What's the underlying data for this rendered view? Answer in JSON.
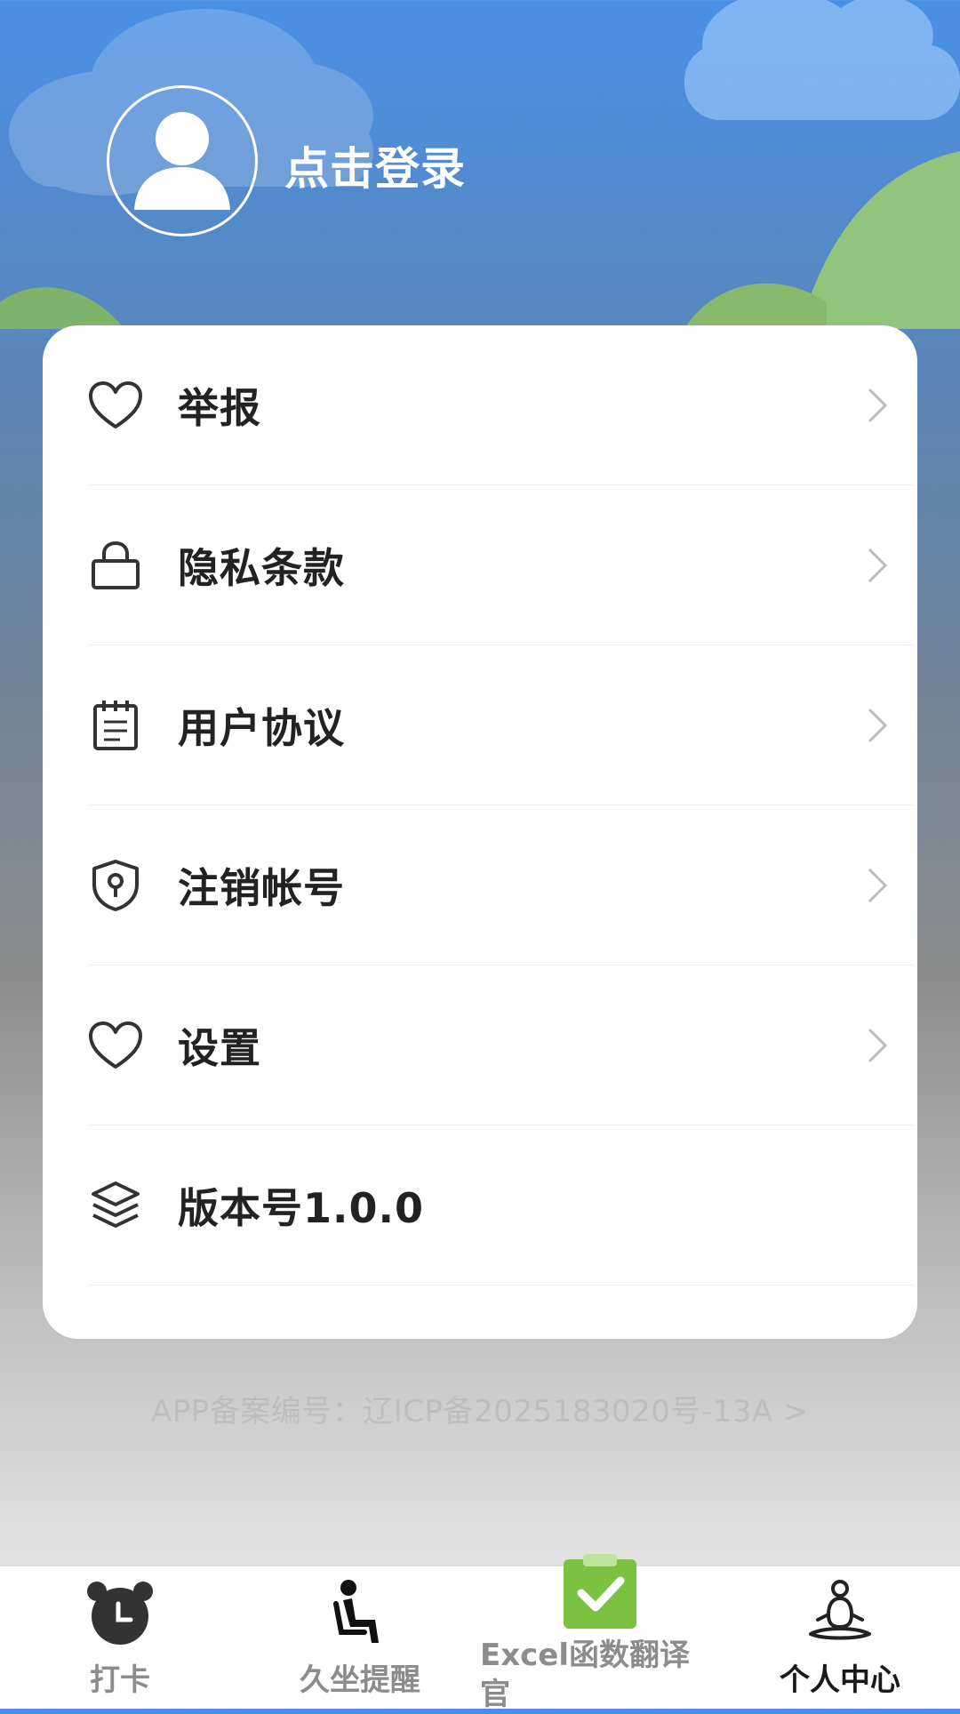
{
  "header": {
    "login_text": "点击登录"
  },
  "menu": [
    {
      "label": "举报",
      "icon": "heart-icon",
      "has_arrow": true
    },
    {
      "label": "隐私条款",
      "icon": "lock-icon",
      "has_arrow": true
    },
    {
      "label": "用户协议",
      "icon": "notepad-icon",
      "has_arrow": true
    },
    {
      "label": "注销帐号",
      "icon": "shield-key-icon",
      "has_arrow": true
    },
    {
      "label": "设置",
      "icon": "heart-icon",
      "has_arrow": true
    },
    {
      "label": "版本号1.0.0",
      "icon": "layers-icon",
      "has_arrow": false
    }
  ],
  "record_text": "APP备案编号：辽ICP备2025183020号-13A >",
  "tabbar": {
    "tabs": [
      {
        "label": "打卡",
        "icon": "alarm-clock-icon",
        "active": false
      },
      {
        "label": "久坐提醒",
        "icon": "seated-person-icon",
        "active": false
      },
      {
        "label": "Excel函数翻译官",
        "icon": "clipboard-check-icon",
        "active": false
      },
      {
        "label": "个人中心",
        "icon": "meditation-icon",
        "active": true
      }
    ]
  },
  "colors": {
    "sky_top": "#4a8fe6",
    "accent_green": "#7cc242",
    "text_dark": "#222222",
    "tab_inactive": "#8c8c8c"
  }
}
